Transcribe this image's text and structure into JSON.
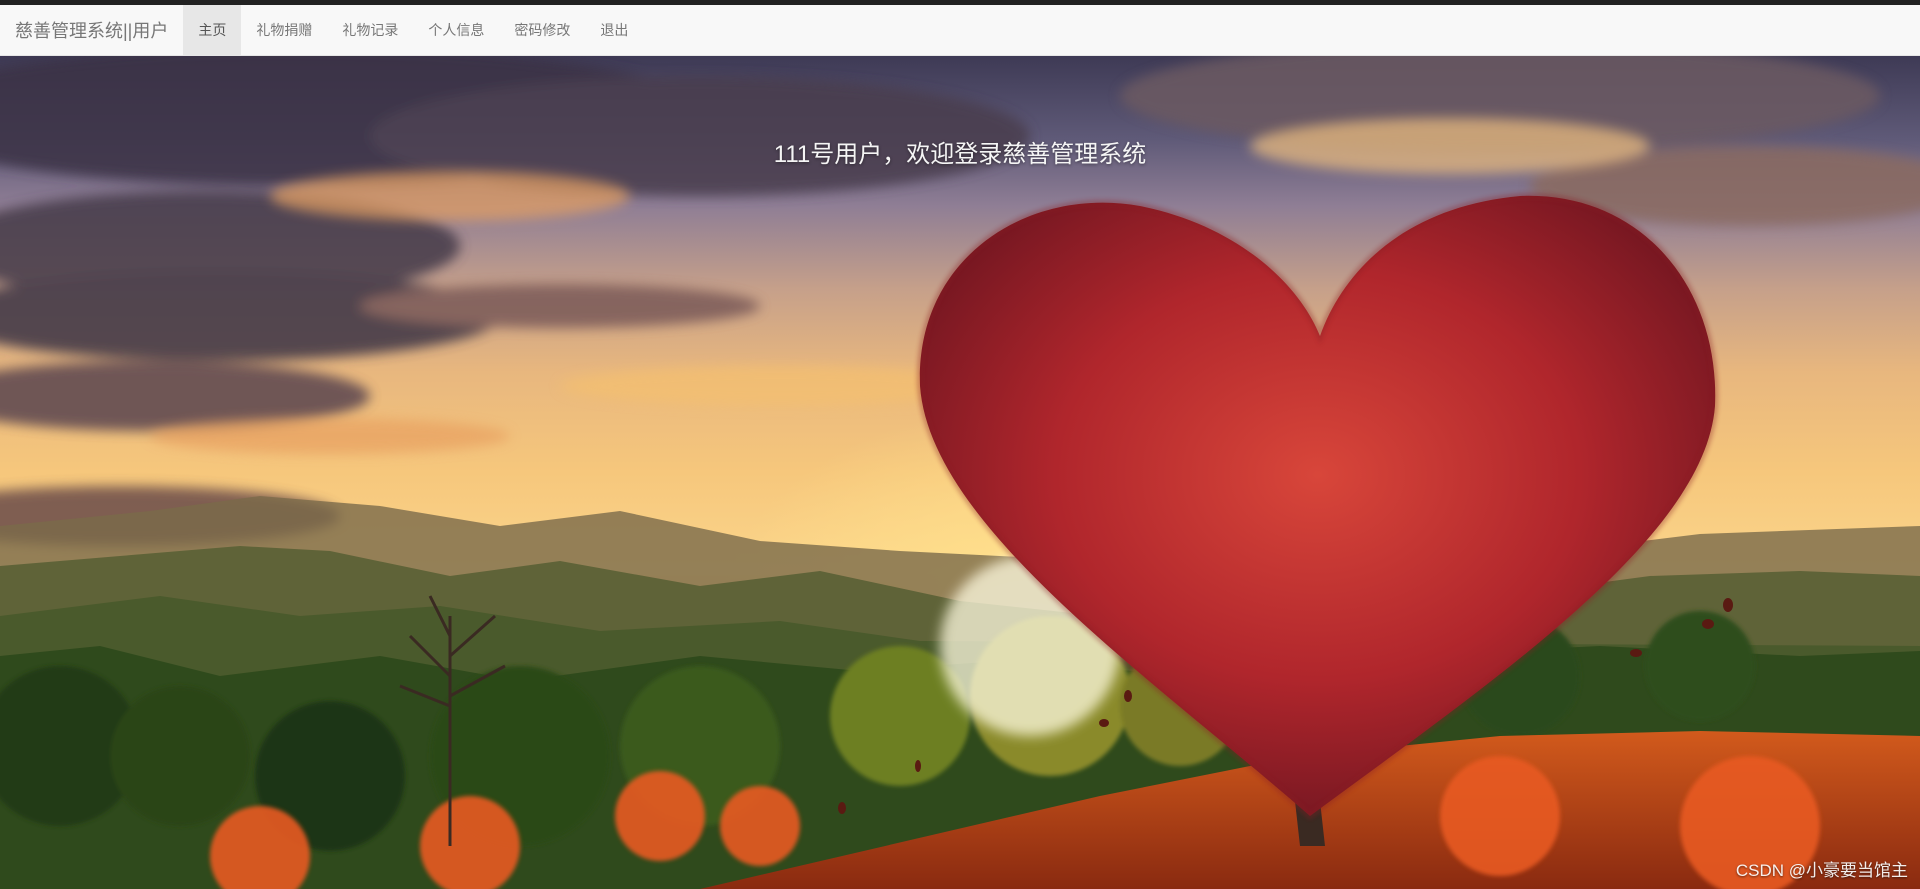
{
  "navbar": {
    "brand": "慈善管理系统||用户",
    "items": [
      {
        "label": "主页",
        "active": true
      },
      {
        "label": "礼物捐赠",
        "active": false
      },
      {
        "label": "礼物记录",
        "active": false
      },
      {
        "label": "个人信息",
        "active": false
      },
      {
        "label": "密码修改",
        "active": false
      },
      {
        "label": "退出",
        "active": false
      }
    ]
  },
  "hero": {
    "welcome_text": "111号用户，欢迎登录慈善管理系统",
    "background": "sunset landscape with heart-shaped red tree"
  },
  "watermark": "CSDN @小豪要当馆主",
  "colors": {
    "navbar_bg": "#f8f8f8",
    "nav_active_bg": "#e7e7e7",
    "nav_text": "#777777",
    "welcome_text": "#f5f5f5",
    "tree_red": "#b52a2e"
  }
}
